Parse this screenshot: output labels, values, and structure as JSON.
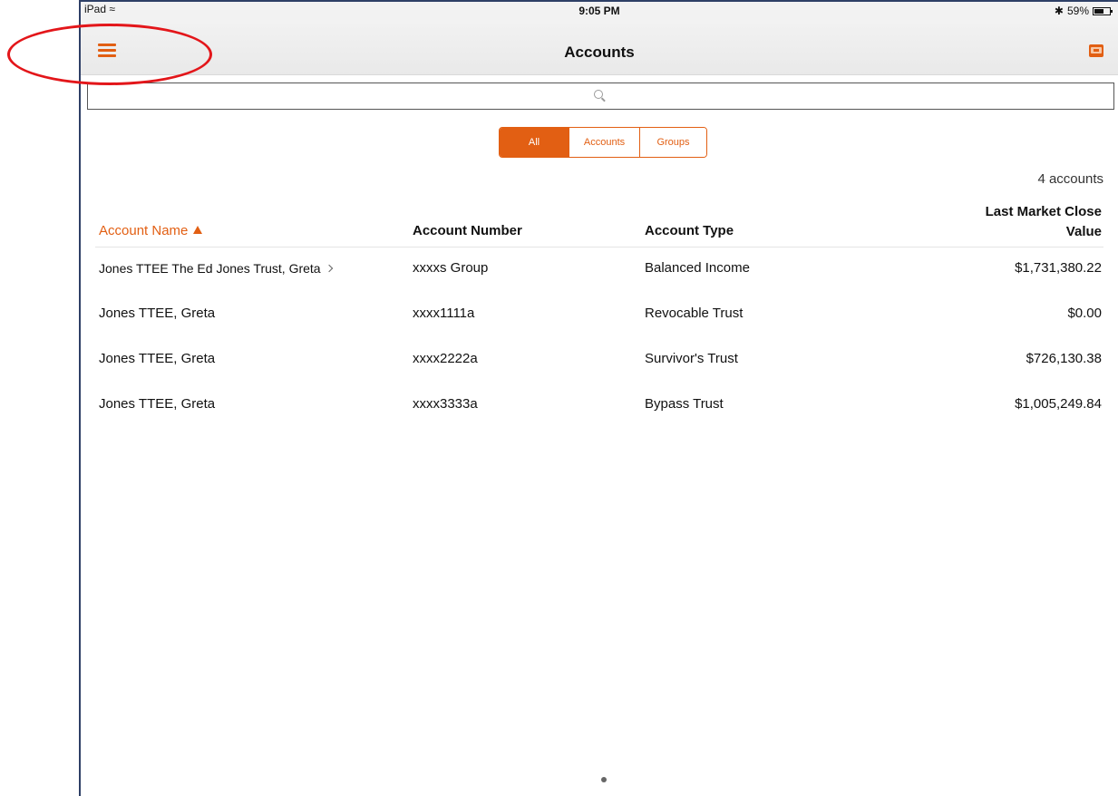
{
  "status_bar": {
    "device": "iPad",
    "time": "9:05 PM",
    "battery": "59%"
  },
  "nav": {
    "title": "Accounts",
    "menu_icon": "hamburger-menu-icon",
    "right_icon": "mail-icon"
  },
  "search": {
    "placeholder": ""
  },
  "segments": [
    {
      "label": "All",
      "active": true
    },
    {
      "label": "Accounts",
      "active": false
    },
    {
      "label": "Groups",
      "active": false
    }
  ],
  "summary": {
    "count": "4 accounts"
  },
  "table": {
    "headers": {
      "name": "Account Name",
      "number": "Account Number",
      "type": "Account Type",
      "value_line1": "Last Market Close",
      "value_line2": "Value"
    },
    "rows": [
      {
        "name": "Jones TTEE The Ed Jones Trust, Greta",
        "number": "xxxxs Group",
        "type": "Balanced Income",
        "value": "$1,731,380.22"
      },
      {
        "name": "Jones TTEE, Greta",
        "number": "xxxx1111a",
        "type": "Revocable Trust",
        "value": "$0.00"
      },
      {
        "name": "Jones TTEE, Greta",
        "number": "xxxx2222a",
        "type": "Survivor's Trust",
        "value": "$726,130.38"
      },
      {
        "name": "Jones TTEE, Greta",
        "number": "xxxx3333a",
        "type": "Bypass Trust",
        "value": "$1,005,249.84"
      }
    ]
  },
  "colors": {
    "accent": "#e25f13",
    "annotation": "#e3161a"
  }
}
